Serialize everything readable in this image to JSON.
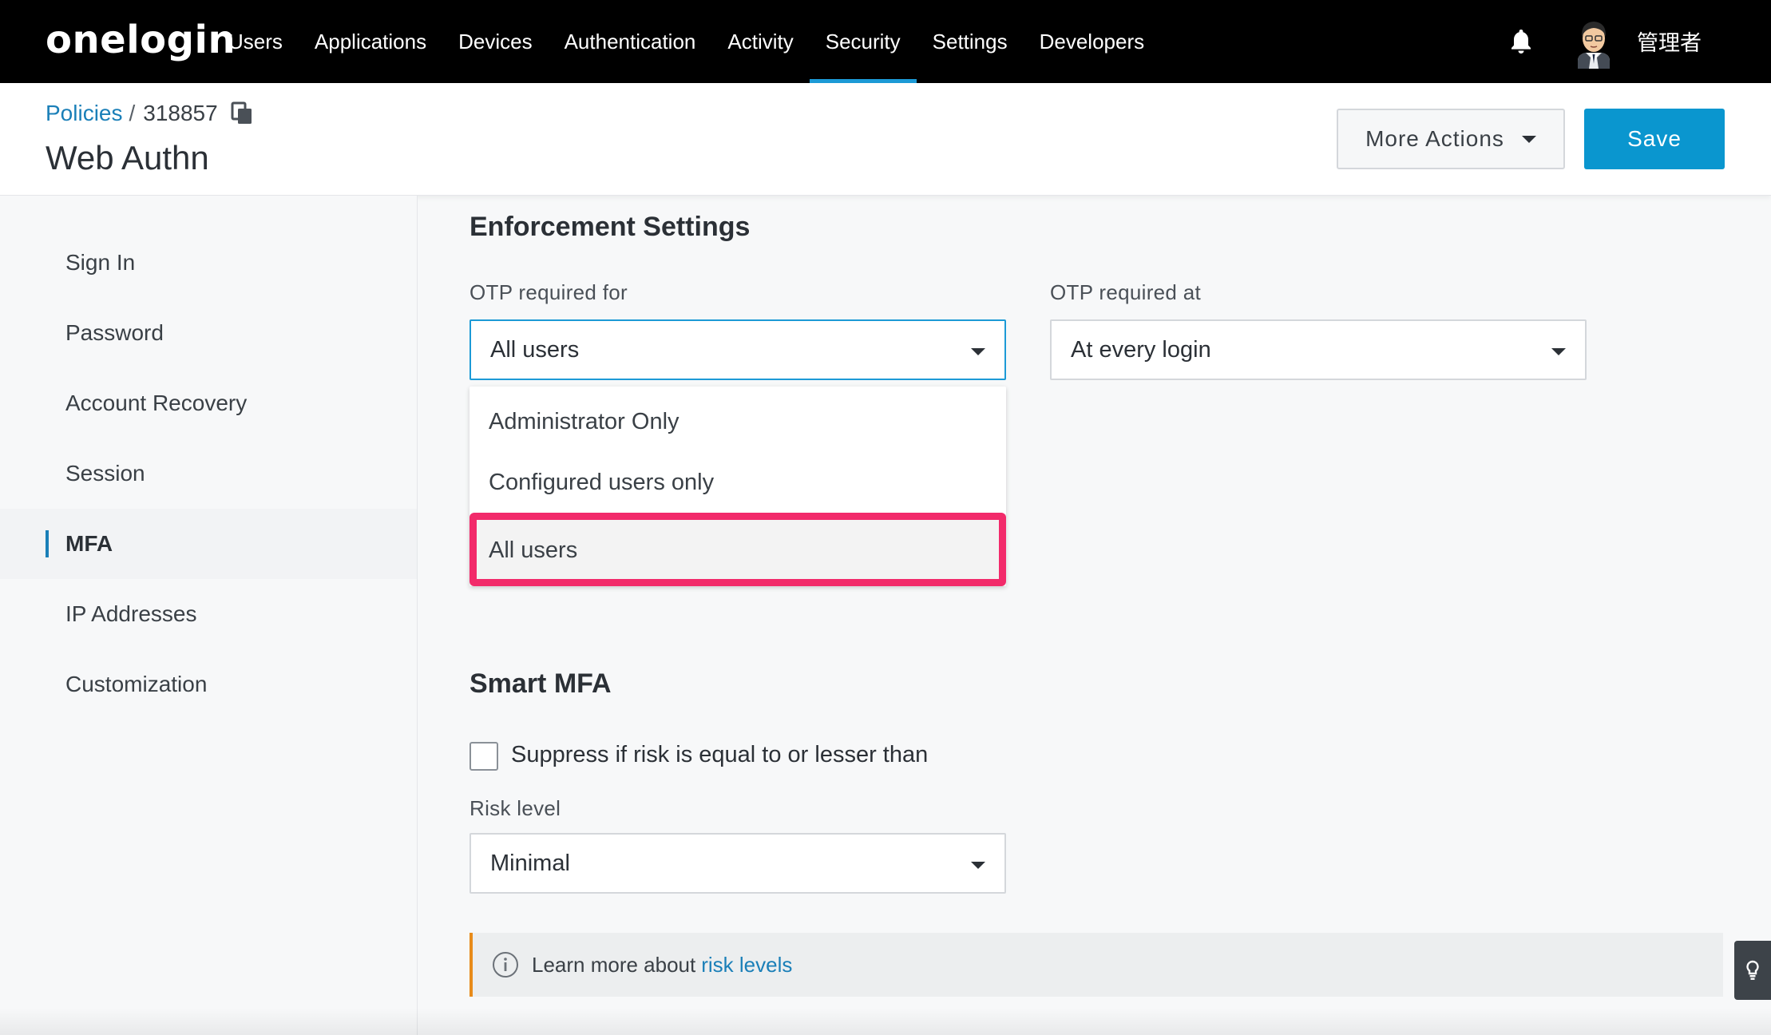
{
  "app": {
    "logo": "onelogin",
    "nav": [
      "Users",
      "Applications",
      "Devices",
      "Authentication",
      "Activity",
      "Security",
      "Settings",
      "Developers"
    ],
    "active_nav": "Security",
    "user": "管理者"
  },
  "header": {
    "breadcrumb_link": "Policies",
    "breadcrumb_sep": "/",
    "policy_id": "318857",
    "title": "Web Authn",
    "more_actions": "More Actions",
    "save": "Save"
  },
  "sidebar": {
    "items": [
      "Sign In",
      "Password",
      "Account Recovery",
      "Session",
      "MFA",
      "IP Addresses",
      "Customization"
    ],
    "active": "MFA"
  },
  "enforcement": {
    "title": "Enforcement Settings",
    "otp_for_label": "OTP required for",
    "otp_for_value": "All users",
    "otp_at_label": "OTP required at",
    "otp_at_value": "At every login",
    "dropdown_options": [
      "Administrator Only",
      "Configured users only",
      "All users"
    ],
    "dropdown_selected": "All users"
  },
  "smart_mfa": {
    "title": "Smart MFA",
    "suppress_label": "Suppress if risk is equal to or lesser than",
    "suppress_checked": false,
    "risk_label": "Risk level",
    "risk_value": "Minimal"
  },
  "info": {
    "text": "Learn more about",
    "link": "risk levels"
  },
  "colors": {
    "nav_bg": "#000000",
    "accent": "#1c9ad6",
    "save_bg": "#0a96cf",
    "highlight": "#f22a6a",
    "info_border": "#e88b1a"
  }
}
